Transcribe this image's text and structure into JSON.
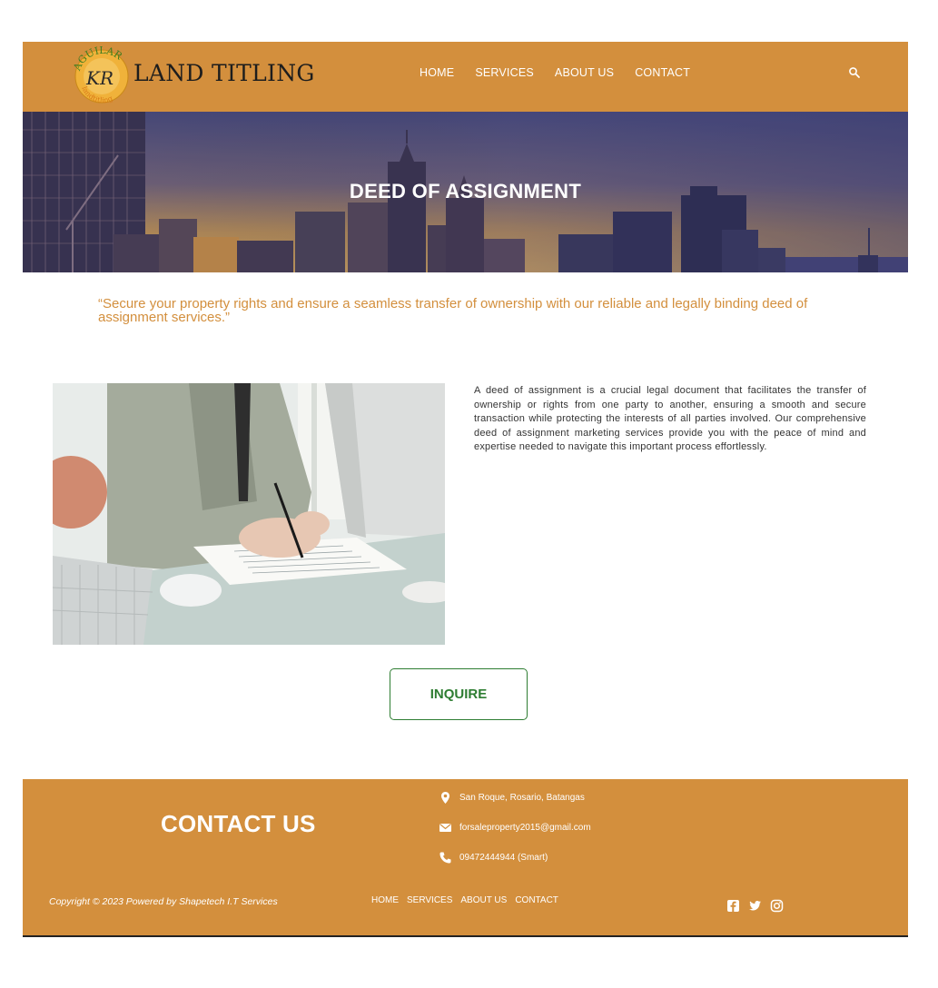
{
  "header": {
    "logo_text": "AGUILAR KR landtitling",
    "brand": "LAND TITLING",
    "nav": [
      "HOME",
      "SERVICES",
      "ABOUT US",
      "CONTACT"
    ]
  },
  "hero": {
    "title": "DEED OF ASSIGNMENT"
  },
  "quote": "“Secure your property rights and ensure a seamless transfer of ownership with our reliable and legally binding deed of assignment services.”",
  "description": "A deed of assignment is a crucial legal document that facilitates the transfer of ownership or rights from one party to another, ensuring a smooth and secure transaction while protecting the interests of all parties involved. Our comprehensive deed of assignment marketing services provide you with the peace of mind and expertise needed to navigate this important process effortlessly.",
  "inquire_label": "INQUIRE",
  "footer": {
    "contact_title": "CONTACT US",
    "address": "San Roque, Rosario, Batangas",
    "email": "forsaleproperty2015@gmail.com",
    "phone": "09472444944 (Smart)",
    "copyright": "Copyright © 2023 Powered by Shapetech I.T Services",
    "nav": [
      "HOME",
      "SERVICES",
      "ABOUT US",
      "CONTACT"
    ]
  },
  "colors": {
    "brand": "#d38f3d",
    "accent_green": "#2e7d32",
    "quote": "#d38f3d"
  },
  "icons": [
    "search-icon",
    "location-icon",
    "email-icon",
    "phone-icon",
    "facebook-icon",
    "twitter-icon",
    "instagram-icon"
  ]
}
